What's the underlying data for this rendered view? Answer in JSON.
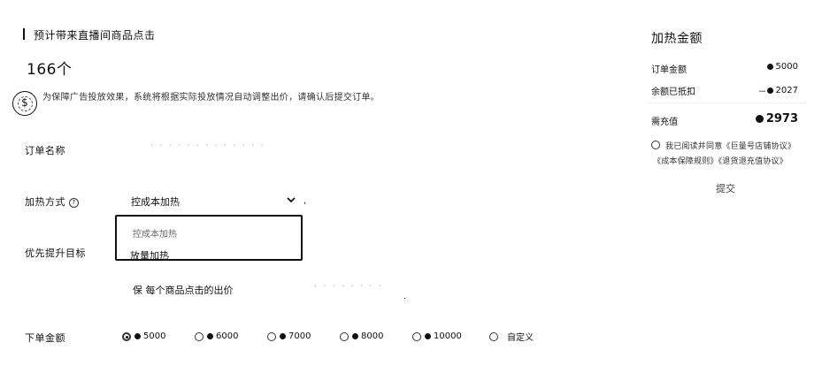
{
  "estimate": {
    "title": "预计带来直播间商品点击",
    "value": "166个",
    "notice": "为保障广告投放效果，系统将根据实际投放情况自动调整出价，请确认后提交订单。",
    "notice_icon": "coin-seal-icon",
    "notice_icon_glyph": "$"
  },
  "form": {
    "order_name": {
      "label": "订单名称",
      "value": "· · · · · ·  · · ·  · ·  · ·"
    },
    "heat_method": {
      "label": "加热方式",
      "info_icon_glyph": "?",
      "selected": "控成本加热",
      "options": [
        "控成本加热",
        "放量加热"
      ],
      "trailing_mark": ","
    },
    "priority_target": {
      "label": "优先提升目标"
    },
    "bid": {
      "label": "每个商品点击的出价",
      "prefix": "保",
      "dots": "· · ·  · · ·  · ·",
      "trailing_mark": "."
    },
    "amount": {
      "label": "下单金额",
      "options": [
        {
          "label": "5000",
          "coin": true,
          "checked": true
        },
        {
          "label": "6000",
          "coin": true,
          "checked": false
        },
        {
          "label": "7000",
          "coin": true,
          "checked": false
        },
        {
          "label": "8000",
          "coin": true,
          "checked": false
        },
        {
          "label": "10000",
          "coin": true,
          "checked": false
        },
        {
          "label": "自定义",
          "coin": false,
          "checked": false
        }
      ]
    }
  },
  "summary": {
    "title": "加热金额",
    "order_amount_label": "订单金额",
    "order_amount_value": "5000",
    "deduct_label": "余额已抵扣",
    "deduct_prefix": "－",
    "deduct_value": "2027",
    "pay_label": "需充值",
    "pay_value": "2973",
    "agreement_line1": "我已阅读并同意《巨量号店铺协议》",
    "agreement_line2": "《成本保障规则》《退货退充值协议》",
    "submit_label": "提交"
  },
  "colors": {
    "text": "#111111",
    "muted": "#666666",
    "border": "#111111"
  }
}
